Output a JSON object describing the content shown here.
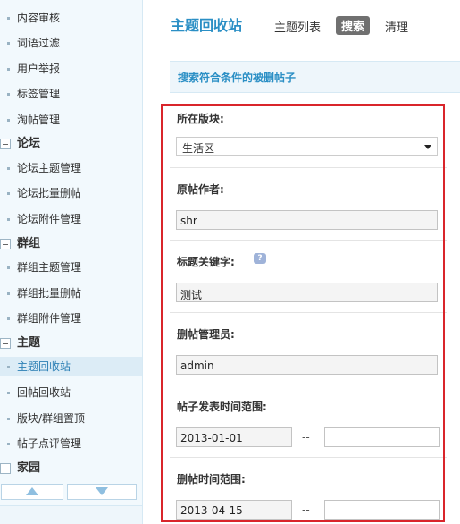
{
  "sidebar": {
    "items": [
      {
        "type": "sub",
        "label": "内容审核"
      },
      {
        "type": "sub",
        "label": "词语过滤"
      },
      {
        "type": "sub",
        "label": "用户举报"
      },
      {
        "type": "sub",
        "label": "标签管理"
      },
      {
        "type": "sub",
        "label": "淘帖管理"
      },
      {
        "type": "head",
        "label": "论坛"
      },
      {
        "type": "sub",
        "label": "论坛主题管理"
      },
      {
        "type": "sub",
        "label": "论坛批量删帖"
      },
      {
        "type": "sub",
        "label": "论坛附件管理"
      },
      {
        "type": "head",
        "label": "群组"
      },
      {
        "type": "sub",
        "label": "群组主题管理"
      },
      {
        "type": "sub",
        "label": "群组批量删帖"
      },
      {
        "type": "sub",
        "label": "群组附件管理"
      },
      {
        "type": "head",
        "label": "主题"
      },
      {
        "type": "sub",
        "label": "主题回收站",
        "active": true
      },
      {
        "type": "sub",
        "label": "回帖回收站"
      },
      {
        "type": "sub",
        "label": "版块/群组置顶"
      },
      {
        "type": "sub",
        "label": "帖子点评管理"
      },
      {
        "type": "head",
        "label": "家园"
      }
    ]
  },
  "header": {
    "title": "主题回收站",
    "nav": [
      "主题列表",
      "搜索",
      "清理"
    ],
    "active_nav": "搜索"
  },
  "section": {
    "title": "搜索符合条件的被删帖子"
  },
  "form": {
    "forum_label": "所在版块:",
    "forum_value": "生活区",
    "author_label": "原帖作者:",
    "author_value": "shr",
    "keyword_label": "标题关键字:",
    "keyword_value": "测试",
    "admin_label": "删帖管理员:",
    "admin_value": "admin",
    "post_time_label": "帖子发表时间范围:",
    "post_time_start": "2013-01-01",
    "post_time_end": "",
    "delete_time_label": "删帖时间范围:",
    "delete_time_start": "2013-04-15",
    "delete_time_end": "",
    "range_separator": "--"
  },
  "icons": {
    "help": "help-icon",
    "scroll_up": "arrow-up-icon",
    "scroll_down": "arrow-down-icon"
  },
  "colors": {
    "accent": "#2b8fc5",
    "highlight_border": "#d9252b"
  }
}
